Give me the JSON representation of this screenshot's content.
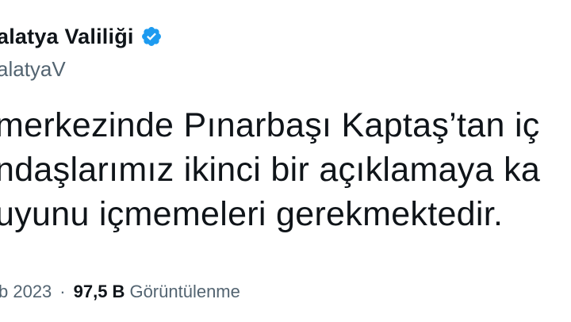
{
  "tweet": {
    "display_name": "alatya Valiliği",
    "handle": "alatyaV",
    "handle_prefix_glyph": "l",
    "verified_icon": "verified-badge-icon",
    "verified_color": "#1d9bf0",
    "text_lines": [
      "merkezinde Pınarbaşı Kaptaş’tan iç",
      "ndaşlarımız ikinci bir açıklamaya ka",
      "uyunu içmemeleri gerekmektedir."
    ],
    "date": "b 2023",
    "separator": "·",
    "views_count": "97,5 B",
    "views_label": "Görüntülenme"
  }
}
